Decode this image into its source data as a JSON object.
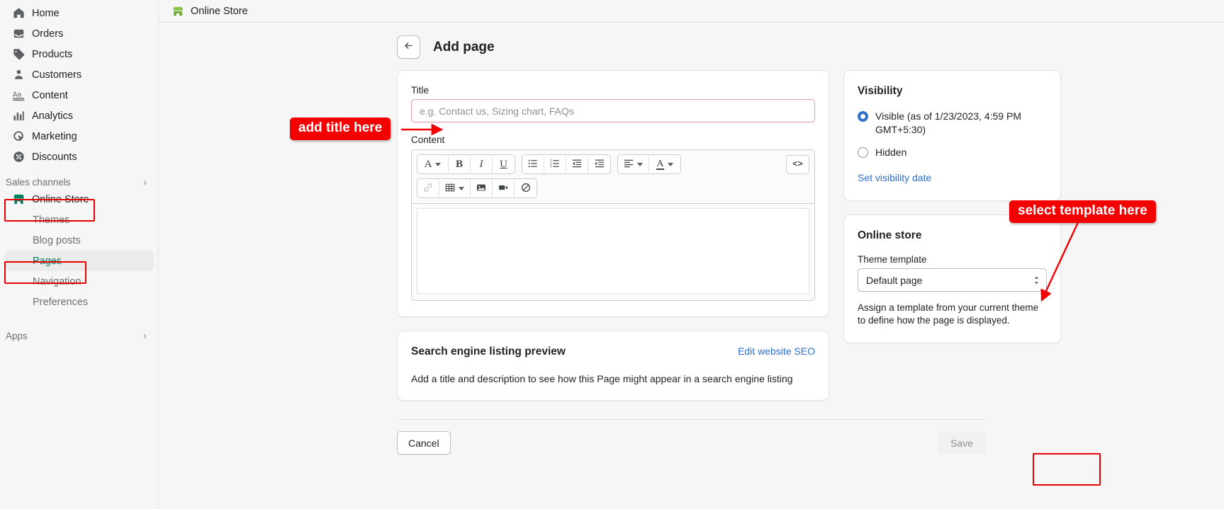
{
  "sidebar": {
    "items": [
      {
        "label": "Home",
        "icon": "home-icon"
      },
      {
        "label": "Orders",
        "icon": "orders-icon"
      },
      {
        "label": "Products",
        "icon": "tag-icon"
      },
      {
        "label": "Customers",
        "icon": "person-icon"
      },
      {
        "label": "Content",
        "icon": "content-icon"
      },
      {
        "label": "Analytics",
        "icon": "bar-chart-icon"
      },
      {
        "label": "Marketing",
        "icon": "marketing-icon"
      },
      {
        "label": "Discounts",
        "icon": "discount-icon"
      }
    ],
    "sales_channels": {
      "label": "Sales channels",
      "chevron": "›"
    },
    "online_store": {
      "label": "Online Store",
      "icon": "store-icon"
    },
    "sub_items": [
      {
        "label": "Themes",
        "active": false
      },
      {
        "label": "Blog posts",
        "active": false
      },
      {
        "label": "Pages",
        "active": true
      },
      {
        "label": "Navigation",
        "active": false
      },
      {
        "label": "Preferences",
        "active": false
      }
    ],
    "apps": {
      "label": "Apps",
      "chevron": "›"
    }
  },
  "topbar": {
    "store_name": "Online Store",
    "icon": "store-icon"
  },
  "page": {
    "back_icon": "arrow-left-icon",
    "title": "Add page"
  },
  "title_card": {
    "label": "Title",
    "placeholder": "e.g. Contact us, Sizing chart, FAQs",
    "value": ""
  },
  "content_card": {
    "label": "Content",
    "toolbar_row1": [
      {
        "name": "format-text-button",
        "glyph": "A",
        "dropdown": true
      },
      {
        "name": "bold-button",
        "glyph": "B",
        "dropdown": false
      },
      {
        "name": "italic-button",
        "glyph": "I",
        "dropdown": false
      },
      {
        "name": "underline-button",
        "glyph": "U",
        "dropdown": false
      }
    ],
    "toolbar_row1b": [
      {
        "name": "bulleted-list-button",
        "glyph": "bullet-list-icon"
      },
      {
        "name": "numbered-list-button",
        "glyph": "numbered-list-icon"
      },
      {
        "name": "outdent-button",
        "glyph": "outdent-icon"
      },
      {
        "name": "indent-button",
        "glyph": "indent-icon"
      }
    ],
    "toolbar_row1c": [
      {
        "name": "align-button",
        "glyph": "align-left-icon",
        "dropdown": true
      },
      {
        "name": "text-color-button",
        "glyph": "A",
        "dropdown": true
      }
    ],
    "code_button": {
      "name": "show-html-button",
      "glyph": "<>"
    },
    "toolbar_row2": [
      {
        "name": "insert-link-button",
        "glyph": "link-icon",
        "disabled": true
      },
      {
        "name": "insert-table-button",
        "glyph": "table-icon",
        "dropdown": true
      },
      {
        "name": "insert-image-button",
        "glyph": "image-icon"
      },
      {
        "name": "insert-video-button",
        "glyph": "video-icon"
      },
      {
        "name": "clear-formatting-button",
        "glyph": "clear-format-icon"
      }
    ],
    "body_value": ""
  },
  "seo_card": {
    "title": "Search engine listing preview",
    "edit_link": "Edit website SEO",
    "description": "Add a title and description to see how this Page might appear in a search engine listing"
  },
  "visibility_card": {
    "title": "Visibility",
    "options": [
      {
        "label": "Visible (as of 1/23/2023, 4:59 PM GMT+5:30)",
        "selected": true
      },
      {
        "label": "Hidden",
        "selected": false
      }
    ],
    "set_date_link": "Set visibility date"
  },
  "online_store_card": {
    "title": "Online store",
    "field_label": "Theme template",
    "selected_value": "Default page",
    "options": [
      "Default page"
    ],
    "helper_text": "Assign a template from your current theme to define how the page is displayed."
  },
  "footer": {
    "cancel_label": "Cancel",
    "save_label": "Save"
  },
  "annotations": {
    "add_title": "add title here",
    "select_template": "select template here",
    "accent_color": "#f40000"
  }
}
